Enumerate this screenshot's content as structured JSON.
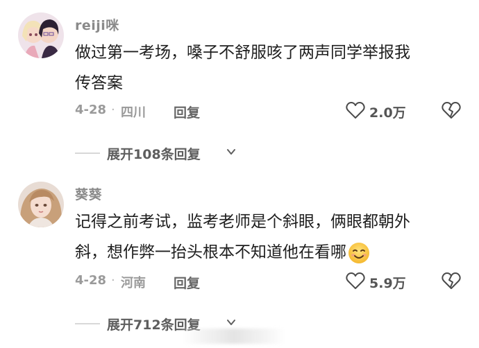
{
  "comments": [
    {
      "username": "reiji咪",
      "content_line1": "做过第一考场，嗓子不舒服咳了两声同学举报我",
      "content_line2": "传答案",
      "date": "4-28",
      "dot": "·",
      "location": "四川",
      "reply_label": "回复",
      "like_count": "2.0万",
      "expand_label": "展开108条回复",
      "icons": {
        "like": "heart-outline-icon",
        "dislike": "broken-heart-icon",
        "expand": "chevron-down-icon"
      }
    },
    {
      "username": "葵葵",
      "content_line1": "记得之前考试，监考老师是个斜眼，俩眼都朝外",
      "content_line2": "斜，想作弊一抬头根本不知道他在看哪",
      "date": "4-28",
      "dot": "·",
      "location": "河南",
      "reply_label": "回复",
      "like_count": "5.9万",
      "expand_label": "展开712条回复",
      "icons": {
        "like": "heart-outline-icon",
        "dislike": "broken-heart-icon",
        "expand": "chevron-down-icon",
        "emoji": "smiling-face-emoji"
      }
    }
  ]
}
